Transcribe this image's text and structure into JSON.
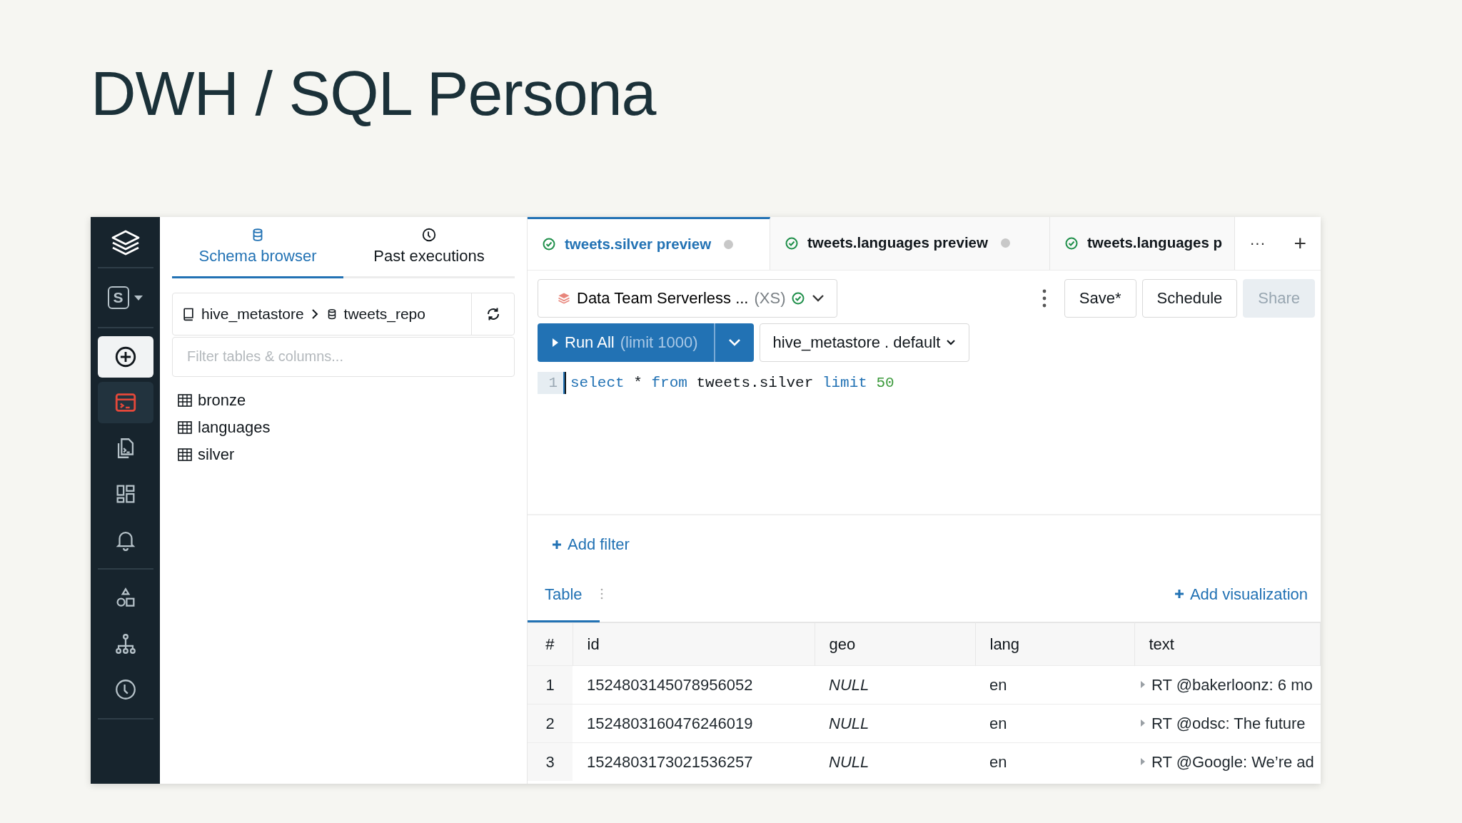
{
  "slide_title": "DWH / SQL Persona",
  "sidebar": {
    "workspace_letter": "S",
    "items": [
      {
        "kind": "create",
        "selected": false
      },
      {
        "kind": "nav",
        "selected": true
      },
      {
        "kind": "nav",
        "selected": false
      },
      {
        "kind": "nav",
        "selected": false
      },
      {
        "kind": "nav",
        "selected": false
      },
      {
        "kind": "nav",
        "selected": false
      },
      {
        "kind": "nav",
        "selected": false
      },
      {
        "kind": "nav",
        "selected": false
      }
    ]
  },
  "schema_panel": {
    "tabs": [
      {
        "label": "Schema browser",
        "selected": true
      },
      {
        "label": "Past executions",
        "selected": false
      }
    ],
    "catalog": "hive_metastore",
    "schema": "tweets_repo",
    "filter": {
      "placeholder": "Filter tables & columns..."
    },
    "tables": [
      "bronze",
      "languages",
      "silver"
    ]
  },
  "editor_tabs": [
    {
      "label": "tweets.silver preview",
      "selected": true,
      "unsaved": true
    },
    {
      "label": "tweets.languages preview",
      "selected": false,
      "unsaved": true
    },
    {
      "label": "tweets.languages p",
      "selected": false
    }
  ],
  "tab_more": "···",
  "tab_add": "+",
  "warehouse": {
    "name": "Data Team Serverless ...",
    "size": "(XS)"
  },
  "buttons": [
    {
      "label": "Save*",
      "disabled": false
    },
    {
      "label": "Schedule",
      "disabled": false
    },
    {
      "label": "Share",
      "disabled": true
    }
  ],
  "run": {
    "label": "Run All",
    "limit": "(limit 1000)"
  },
  "schema_select": "hive_metastore . default",
  "code_lines": [
    {
      "number": "1",
      "tokens": [
        {
          "kind": "keyword",
          "text": "select"
        },
        {
          "kind": "plain",
          "text": " * "
        },
        {
          "kind": "keyword",
          "text": "from"
        },
        {
          "kind": "plain",
          "text": " tweets.silver "
        },
        {
          "kind": "keyword",
          "text": "limit"
        },
        {
          "kind": "number",
          "text": " 50"
        }
      ]
    }
  ],
  "add_filter": "Add filter",
  "result_tabs": [
    {
      "label": "Table",
      "selected": true
    }
  ],
  "add_visualization": "Add visualization",
  "table": {
    "columns": [
      {
        "label": "#",
        "kind": "index"
      },
      {
        "label": "id",
        "kind": "plain"
      },
      {
        "label": "geo",
        "kind": "null"
      },
      {
        "label": "lang",
        "kind": "plain"
      },
      {
        "label": "text",
        "kind": "expand"
      }
    ],
    "rows": [
      [
        "1",
        "1524803145078956052",
        "NULL",
        "en",
        "RT @bakerloonz: 6 mo"
      ],
      [
        "2",
        "1524803160476246019",
        "NULL",
        "en",
        "RT @odsc: The future"
      ],
      [
        "3",
        "1524803173021536257",
        "NULL",
        "en",
        "RT @Google: We’re ad"
      ]
    ]
  }
}
